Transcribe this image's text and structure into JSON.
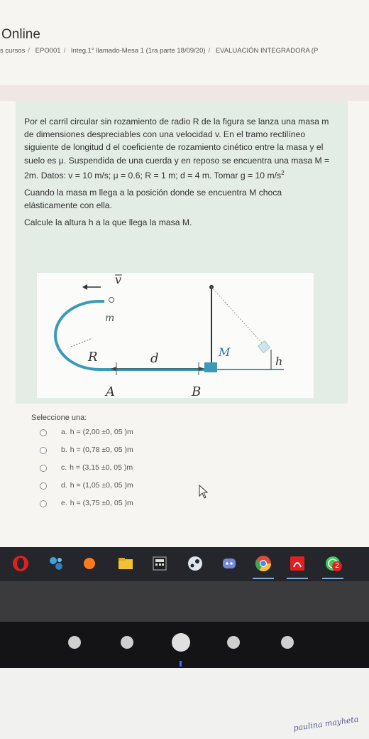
{
  "header": {
    "site_title": "Online",
    "breadcrumb": [
      "s cursos",
      "EPO001",
      "Integ.1° llamado-Mesa 1 (1ra parte 18/09/20)",
      "EVALUACIÓN INTEGRADORA (P"
    ]
  },
  "question": {
    "paragraph1": "Por el carril circular sin rozamiento de radio R de la figura se lanza una masa m de dimensiones despreciables con una velocidad v. En el tramo rectilíneo siguiente de longitud d el coeficiente de rozamiento cinético entre la masa y el suelo es μ. Suspendida de una cuerda y en reposo se encuentra una masa M = 2m. Datos: v = 10 m/s; μ = 0.6; R = 1 m; d = 4 m. Tomar g = 10 m/s",
    "paragraph1_sup": "2",
    "paragraph2": "Cuando la masa m llega a la posición donde se encuentra M choca elásticamente con ella.",
    "paragraph3": "Calcule la altura h a la que llega la masa M."
  },
  "figure": {
    "label_v": "v",
    "label_m": "m",
    "label_R": "R",
    "label_d": "d",
    "label_M": "M",
    "label_h": "h",
    "label_A": "A",
    "label_B": "B"
  },
  "answers": {
    "prompt": "Seleccione una:",
    "options": [
      {
        "letter": "a.",
        "text": "h = (2,00 ±0, 05 )m"
      },
      {
        "letter": "b.",
        "text": "h = (0,78 ±0, 05 )m"
      },
      {
        "letter": "c.",
        "text": "h = (3,15 ±0, 05 )m"
      },
      {
        "letter": "d.",
        "text": "h = (1,05 ±0, 05 )m"
      },
      {
        "letter": "e.",
        "text": "h = (3,75 ±0, 05 )m"
      }
    ]
  },
  "taskbar": {
    "icons": [
      "opera-icon",
      "network-app-icon",
      "orange-circle-icon",
      "file-explorer-icon",
      "calculator-icon",
      "steam-icon",
      "discord-icon",
      "chrome-icon",
      "acrobat-icon",
      "whatsapp-icon"
    ],
    "whatsapp_badge": "2"
  },
  "desk": {
    "handwriting": "paulina mayheta"
  },
  "colors": {
    "question_bg": "#e4ece6",
    "band_bg": "#f0e6e4",
    "taskbar_bg": "#25262b"
  }
}
